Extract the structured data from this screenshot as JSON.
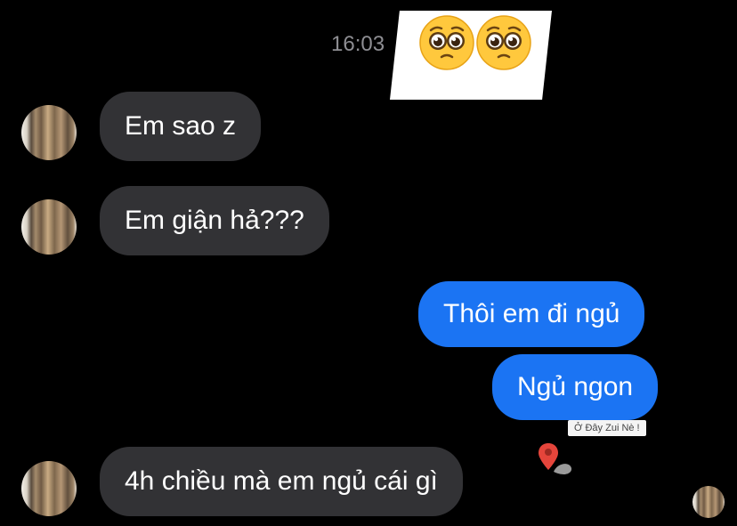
{
  "conversation": {
    "time_label": "16:03",
    "sticker": {
      "emojis": [
        "pleading-face",
        "pleading-face"
      ]
    },
    "messages": [
      {
        "from": "contact",
        "text": "Em sao z"
      },
      {
        "from": "contact",
        "text": "Em giận hả???"
      },
      {
        "from": "me",
        "text": "Thôi em đi ngủ"
      },
      {
        "from": "me",
        "text": "Ngủ ngon"
      },
      {
        "from": "contact",
        "text": "4h chiều mà em ngủ cái gì"
      }
    ],
    "overlay_badge": "Ở Đây Zui Nè !",
    "colors": {
      "background": "#000000",
      "incoming_bubble": "#323235",
      "outgoing_bubble": "#1b74f3",
      "timestamp": "#8e8e93"
    }
  }
}
